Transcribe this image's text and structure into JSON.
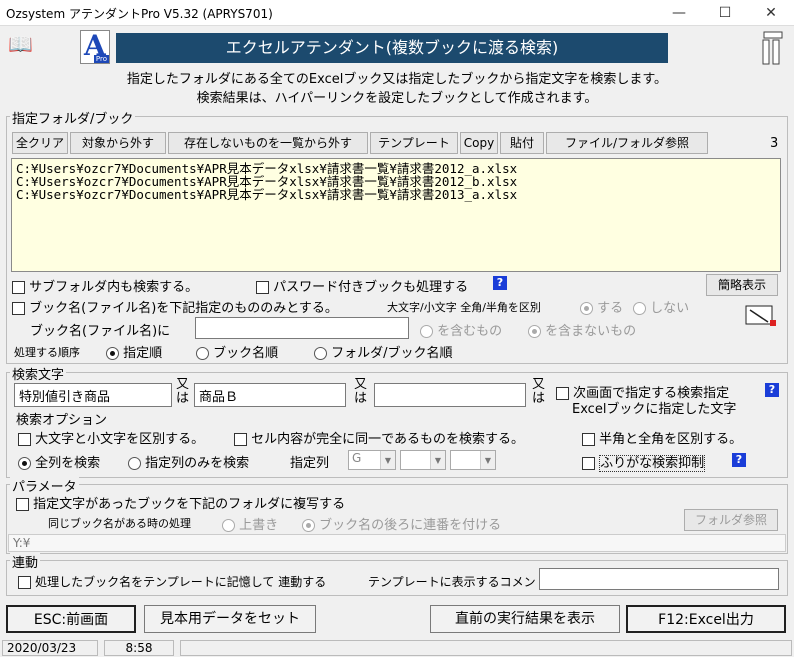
{
  "window": {
    "title": "Ozsystem アテンダントPro V5.32 (APRYS701)"
  },
  "banner": {
    "title": "エクセルアテンダント(複数ブックに渡る検索)"
  },
  "description": {
    "line1": "指定したフォルダにある全てのExcelブック又は指定したブックから指定文字を検索します。",
    "line2": "検索結果は、ハイパーリンクを設定したブックとして作成されます。"
  },
  "folder_section": {
    "title": "指定フォルダ/ブック",
    "buttons": [
      "全クリア",
      "対象から外す",
      "存在しないものを一覧から外す",
      "テンプレート",
      "Copy",
      "貼付",
      "ファイル/フォルダ参照"
    ],
    "count": "3",
    "files": [
      "C:¥Users¥ozcr7¥Documents¥APR見本データxlsx¥請求書一覧¥請求書2012_a.xlsx",
      "C:¥Users¥ozcr7¥Documents¥APR見本データxlsx¥請求書一覧¥請求書2012_b.xlsx",
      "C:¥Users¥ozcr7¥Documents¥APR見本データxlsx¥請求書一覧¥請求書2013_a.xlsx"
    ],
    "subfolder_label": "サブフォルダ内も検索する。",
    "password_label": "パスワード付きブックも処理する",
    "simple_view": "簡略表示",
    "bookname_only_label": "ブック名(ファイル名)を下記指定のもののみとする。",
    "case_width_label": "大文字/小文字 全角/半角を区別",
    "yes": "する",
    "no": "しない",
    "bookname_field_label": "ブック名(ファイル名)に",
    "bookname_value": "",
    "contains": "を含むもの",
    "not_contains": "を含まないもの",
    "order_label": "処理する順序",
    "order_options": [
      "指定順",
      "ブック名順",
      "フォルダ/ブック名順"
    ]
  },
  "search_section": {
    "title": "検索文字",
    "term1": "特別値引き商品",
    "or1": "又は",
    "term2": "商品Ｂ",
    "or2": "又は",
    "term3": "",
    "or3": "又は",
    "next_screen_label": "次画面で指定する検索指定",
    "next_screen_label2": "Excelブックに指定した文字",
    "options_title": "検索オプション",
    "case_label": "大文字と小文字を区別する。",
    "exact_label": "セル内容が完全に同一であるものを検索する。",
    "width_label": "半角と全角を区別する。",
    "all_columns": "全列を検索",
    "specified_columns": "指定列のみを検索",
    "column_label": "指定列",
    "column1": "G",
    "furigana_label": "ふりがな検索抑制"
  },
  "param_section": {
    "title": "パラメータ",
    "copy_label": "指定文字があったブックを下記のフォルダに複写する",
    "same_name_label": "同じブック名がある時の処理",
    "overwrite": "上書き",
    "serial": "ブック名の後ろに連番を付ける",
    "folder_ref": "フォルダ参照",
    "path": "Y:¥"
  },
  "link_section": {
    "title": "連動",
    "remember_label": "処理したブック名をテンプレートに記憶して 連動する",
    "comment_label": "テンプレートに表示するコメント",
    "comment_value": ""
  },
  "footer": {
    "esc": "ESC:前画面",
    "sample": "見本用データをセット",
    "last_result": "直前の実行結果を表示",
    "f12": "F12:Excel出力"
  },
  "status": {
    "date": "2020/03/23",
    "time": "8:58"
  }
}
